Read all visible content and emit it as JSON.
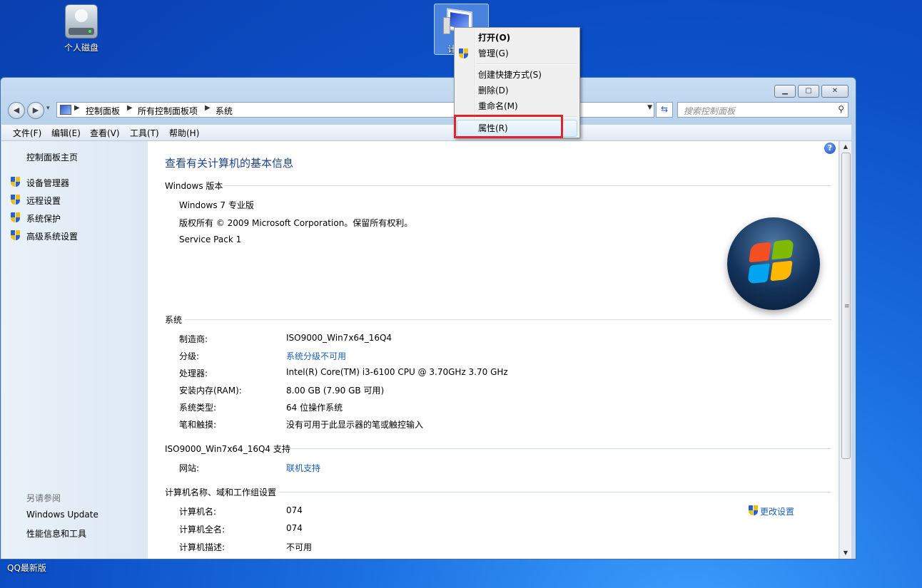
{
  "desktop": {
    "icons": [
      {
        "label": "个人磁盘"
      },
      {
        "label": "计"
      }
    ],
    "taskbar_label": "QQ最新版"
  },
  "window": {
    "controls": {
      "minimize": "▁",
      "maximize": "▢",
      "close": "✕"
    },
    "nav": {
      "back": "◀",
      "forward": "▶",
      "recent": "▾"
    },
    "breadcrumbs": [
      "控制面板",
      "所有控制面板项",
      "系统"
    ],
    "search_placeholder": "搜索控制面板",
    "menus": [
      "文件(F)",
      "编辑(E)",
      "查看(V)",
      "工具(T)",
      "帮助(H)"
    ]
  },
  "left_pane": {
    "home": "控制面板主页",
    "tasks": [
      "设备管理器",
      "远程设置",
      "系统保护",
      "高级系统设置"
    ],
    "see_also_title": "另请参阅",
    "see_also": [
      "Windows Update",
      "性能信息和工具"
    ]
  },
  "content": {
    "title": "查看有关计算机的基本信息",
    "edition_section": "Windows 版本",
    "edition": [
      "Windows 7 专业版",
      "版权所有 © 2009 Microsoft Corporation。保留所有权利。",
      "Service Pack 1"
    ],
    "system_section": "系统",
    "system_rows": [
      {
        "label": "制造商:",
        "value": "ISO9000_Win7x64_16Q4"
      },
      {
        "label": "分级:",
        "value": "系统分级不可用"
      },
      {
        "label": "处理器:",
        "value": "Intel(R) Core(TM) i3-6100 CPU @ 3.70GHz   3.70 GHz"
      },
      {
        "label": "安装内存(RAM):",
        "value": "8.00 GB (7.90 GB 可用)"
      },
      {
        "label": "系统类型:",
        "value": "64 位操作系统"
      },
      {
        "label": "笔和触摸:",
        "value": "没有可用于此显示器的笔或触控输入"
      }
    ],
    "support_section": "ISO9000_Win7x64_16Q4 支持",
    "support_rows": [
      {
        "label": "网站:",
        "value": "联机支持"
      }
    ],
    "computer_section": "计算机名称、域和工作组设置",
    "change_settings": "更改设置",
    "computer_rows": [
      {
        "label": "计算机名:",
        "value": "074"
      },
      {
        "label": "计算机全名:",
        "value": "074"
      },
      {
        "label": "计算机描述:",
        "value": "不可用"
      }
    ]
  },
  "context_menu": {
    "items": [
      "打开(O)",
      "管理(G)",
      "创建快捷方式(S)",
      "删除(D)",
      "重命名(M)",
      "属性(R)"
    ]
  },
  "colors": {
    "link": "#1a5fb4",
    "highlight_box": "#e3232b",
    "title": "#1e3f8a"
  }
}
